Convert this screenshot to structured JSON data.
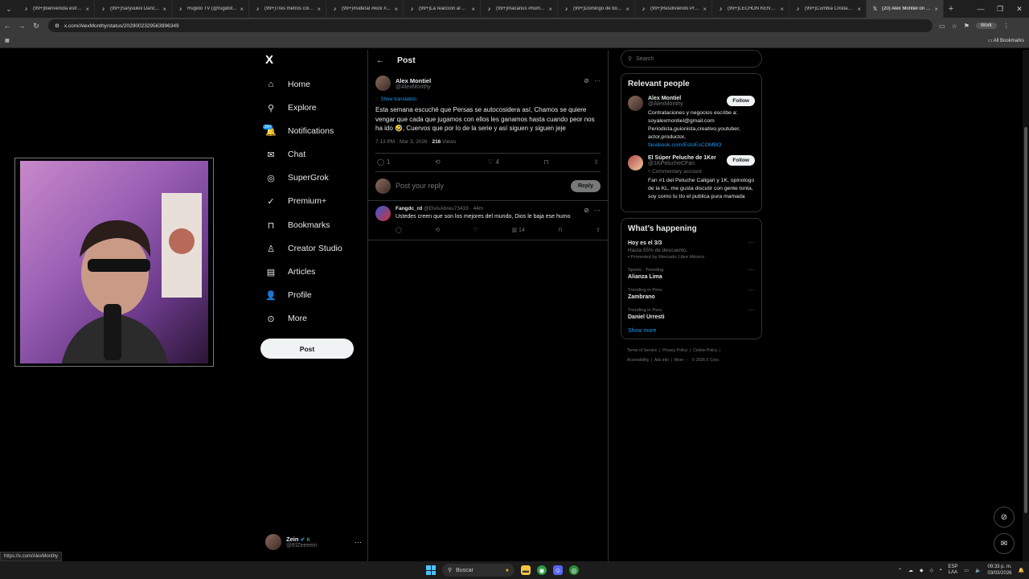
{
  "browser": {
    "tabs": [
      {
        "title": "(99+)bienvenida estrat...",
        "icon": "tiktok"
      },
      {
        "title": "(99+)Saryuukiii Danc...",
        "icon": "tiktok"
      },
      {
        "title": "Rugido TV (@rugidot...",
        "icon": "tiktok"
      },
      {
        "title": "(99+)Tres metros colin...",
        "icon": "tiktok"
      },
      {
        "title": "(99+)#sideral #kick #...",
        "icon": "tiktok"
      },
      {
        "title": "(99+)La reacción al ...",
        "icon": "tiktok"
      },
      {
        "title": "(99+)macarius #hum...",
        "icon": "tiktok"
      },
      {
        "title": "(99+)Domingo de bo...",
        "icon": "tiktok"
      },
      {
        "title": "(99+)Resolviendo Pro...",
        "icon": "tiktok"
      },
      {
        "title": "(99+)LECHÓN KENNI...",
        "icon": "tiktok"
      },
      {
        "title": "(99+)Cumbia Cristian...",
        "icon": "tiktok"
      },
      {
        "title": "(20) Alex Montiel on X...",
        "icon": "x",
        "active": true
      }
    ],
    "url": "x.com/AlexMonthy/status/2029002329563996349",
    "profile_label": "Work",
    "all_bookmarks": "All Bookmarks",
    "status_url": "https://x.com/AlexMonthy"
  },
  "sidebar": {
    "logo": "X",
    "notif_badge": "20+",
    "items": [
      {
        "label": "Home",
        "icon": "home-icon",
        "glyph": "⌂"
      },
      {
        "label": "Explore",
        "icon": "search-icon",
        "glyph": "⚲"
      },
      {
        "label": "Notifications",
        "icon": "bell-icon",
        "glyph": "🔔"
      },
      {
        "label": "Chat",
        "icon": "chat-icon",
        "glyph": "✉"
      },
      {
        "label": "SuperGrok",
        "icon": "grok-icon",
        "glyph": "◎"
      },
      {
        "label": "Premium+",
        "icon": "premium-icon",
        "glyph": "✓"
      },
      {
        "label": "Bookmarks",
        "icon": "bookmark-icon",
        "glyph": "⊓"
      },
      {
        "label": "Creator Studio",
        "icon": "creator-icon",
        "glyph": "♙"
      },
      {
        "label": "Articles",
        "icon": "articles-icon",
        "glyph": "▤"
      },
      {
        "label": "Profile",
        "icon": "profile-icon",
        "glyph": "👤"
      },
      {
        "label": "More",
        "icon": "more-icon",
        "glyph": "⊙"
      }
    ],
    "post_button": "Post",
    "account": {
      "name": "Zein",
      "handle": "@ElZeeeein",
      "badge": "K"
    }
  },
  "main": {
    "header_title": "Post",
    "post": {
      "author": "Alex Montiel",
      "handle": "@AlexMonthy",
      "show_translation": "Show translation",
      "text": "Esta semana escuché que Persas se autocosidera así, Chamos se quiere vengar que cada que jugamos con ellos les ganamos hasta cuando peor nos ha ido 🤣, Cuervos que por lo de la serie y así siguen y siguen jeje",
      "time": "7:13 PM · Mar 3, 2026 · ",
      "views_count": "216",
      "views_label": " Views",
      "reply_count": "1",
      "retweet_count": "",
      "like_count": "4"
    },
    "reply_placeholder": "Post your reply",
    "reply_button": "Reply",
    "comment": {
      "author": "Fangdc_rd",
      "meta": "@ElvisAbreu73433 · 44m",
      "text": "Ustedes creen que son los mejores del mundo, Dios le baja ese humo",
      "views": "14"
    }
  },
  "right": {
    "search_placeholder": "Search",
    "relevant_title": "Relevant people",
    "people": [
      {
        "name": "Alex Montiel",
        "handle": "@AlexMonthy",
        "bio": "Contrataciones y negocios escribe a: soyalexmontiel@gmail.com Periodista,guionista,creativo,youtuber, actor,productor,",
        "link": "facebook.com/EstoEsCOMBO",
        "follow": "Follow"
      },
      {
        "name": "El Súper Peluche de 1Ker",
        "handle": "@1KPelucheCFan",
        "community": "Commentary account",
        "bio": "Fan #1 del Peluche Caligari y 1K, opinologo de la KL, me gusta discutir con gente tonta, soy como tu tío el publica pura mamada",
        "follow": "Follow"
      }
    ],
    "happening_title": "What’s happening",
    "trends": [
      {
        "category": "",
        "title": "Hoy es el 3/3",
        "sub": "Hasta 55% de descuento.",
        "promo": "Promoted by Mercado Libre México"
      },
      {
        "category": "Sports · Trending",
        "title": "Alianza Lima"
      },
      {
        "category": "Trending in Peru",
        "title": "Zambrano"
      },
      {
        "category": "Trending in Peru",
        "title": "Daniel Urresti"
      }
    ],
    "show_more": "Show more",
    "footer": [
      "Terms of Service",
      "Privacy Policy",
      "Cookie Policy",
      "Accessibility",
      "Ads info",
      "More ···",
      "© 2026 X Corp."
    ]
  },
  "taskbar": {
    "search_label": "Buscar",
    "lang_top": "ESP",
    "lang_bottom": "LAA",
    "time": "09:33 p. m.",
    "date": "03/03/2026"
  },
  "colors": {
    "accent": "#1d9bf0",
    "background": "#000000",
    "border": "#2f3336",
    "muted": "#71767b"
  }
}
